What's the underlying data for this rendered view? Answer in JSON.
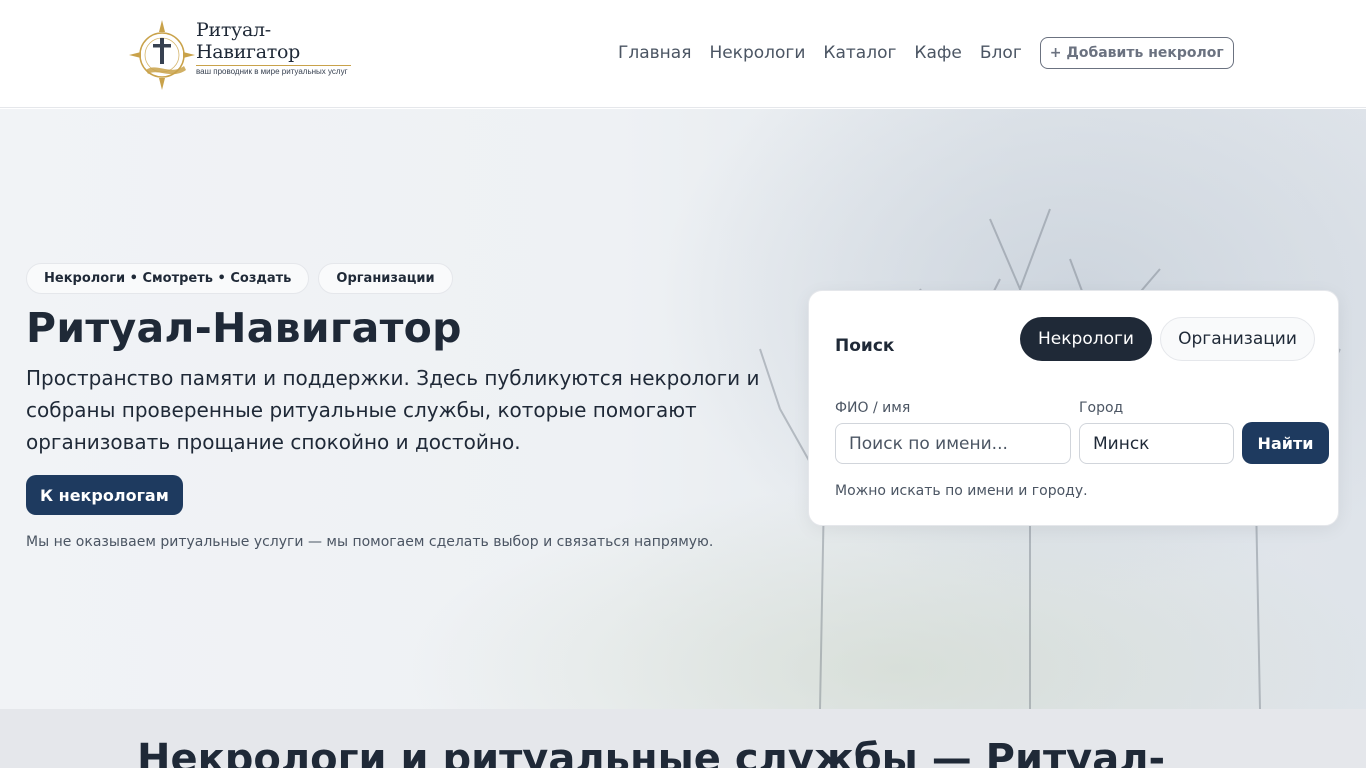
{
  "header": {
    "logo": {
      "title": "Ритуал-Навигатор",
      "subtitle": "ваш проводник в мире ритуальных услуг"
    },
    "nav": [
      {
        "label": "Главная"
      },
      {
        "label": "Некрологи"
      },
      {
        "label": "Каталог"
      },
      {
        "label": "Кафе"
      },
      {
        "label": "Блог"
      }
    ],
    "add_button": "+ Добавить некролог"
  },
  "hero": {
    "chips": [
      "Некрологи • Смотреть • Создать",
      "Организации"
    ],
    "title": "Ритуал-Навигатор",
    "description": "Пространство памяти и поддержки. Здесь публикуются некрологи и собраны проверенные ритуальные службы, которые помогают организовать прощание спокойно и достойно.",
    "cta": "К некрологам",
    "disclaimer": "Мы не оказываем ритуальные услуги — мы помогаем сделать выбор и связаться напрямую."
  },
  "search": {
    "title": "Поиск",
    "tabs": [
      {
        "label": "Некрологи",
        "active": true
      },
      {
        "label": "Организации",
        "active": false
      }
    ],
    "name_label": "ФИО / имя",
    "name_placeholder": "Поиск по имени...",
    "city_label": "Город",
    "city_value": "Минск",
    "button": "Найти",
    "hint": "Можно искать по имени и городу."
  },
  "section": {
    "title": "Некрологи и ритуальные службы — Ритуал-"
  },
  "colors": {
    "primary": "#1e3a5f",
    "dark": "#1f2937",
    "logo_gold": "#c9a24a"
  }
}
